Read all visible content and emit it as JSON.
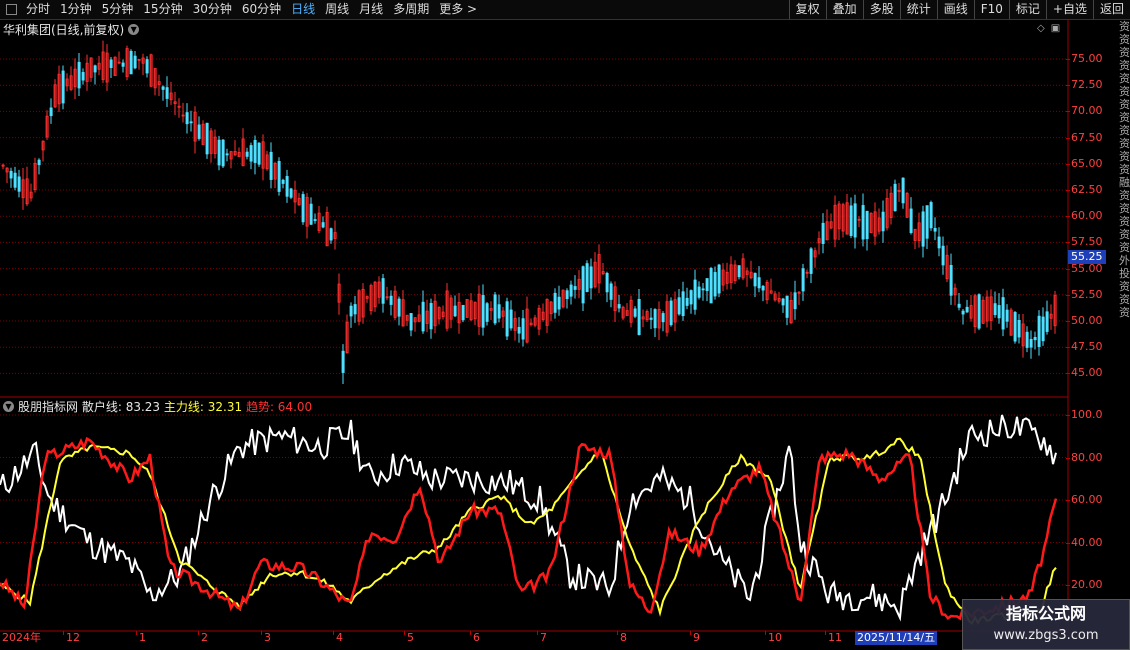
{
  "toolbar": {
    "periods": [
      {
        "label": "分时"
      },
      {
        "label": "1分钟"
      },
      {
        "label": "5分钟"
      },
      {
        "label": "15分钟"
      },
      {
        "label": "30分钟"
      },
      {
        "label": "60分钟"
      },
      {
        "label": "日线",
        "active": true
      },
      {
        "label": "周线"
      },
      {
        "label": "月线"
      },
      {
        "label": "多周期"
      },
      {
        "label": "更多 >"
      }
    ],
    "right_buttons": [
      {
        "label": "复权"
      },
      {
        "label": "叠加"
      },
      {
        "label": "多股"
      },
      {
        "label": "统计"
      },
      {
        "label": "画线"
      },
      {
        "label": "F10"
      },
      {
        "label": "标记"
      },
      {
        "label": "+自选"
      },
      {
        "label": "返回"
      }
    ]
  },
  "stock": {
    "title": "华利集团(日线,前复权)",
    "last_price_tag": "55.25",
    "price_ticks": [
      "75.00",
      "72.50",
      "70.00",
      "67.50",
      "65.00",
      "62.50",
      "60.00",
      "57.50",
      "55.00",
      "52.50",
      "50.00",
      "47.50",
      "45.00"
    ]
  },
  "indicator": {
    "name": "股朋指标网",
    "line1_label": "散户线: 83.23",
    "line2_label": "主力线: 32.31",
    "line3_label": "趋势: 64.00",
    "ticks": [
      "100.0",
      "80.00",
      "60.00",
      "40.00",
      "20.00"
    ],
    "colors": {
      "retail": "#ffffff",
      "main": "#ffff33",
      "trend": "#ff1a1a"
    }
  },
  "xaxis": {
    "labels": [
      "2024年",
      "12",
      "1",
      "2",
      "3",
      "4",
      "5",
      "6",
      "7",
      "8",
      "9",
      "10",
      "11"
    ],
    "cursor_date": "2025/11/14/五"
  },
  "side_strip_text": "资资资资资资资资资资资资融资资资资资外投资资资",
  "watermark": {
    "title": "指标公式网",
    "url": "www.zbgs3.com"
  },
  "colors": {
    "up": "#ff3030",
    "down": "#4fe0ff",
    "grid": "#7a0000",
    "panel_border": "#a00000"
  }
}
